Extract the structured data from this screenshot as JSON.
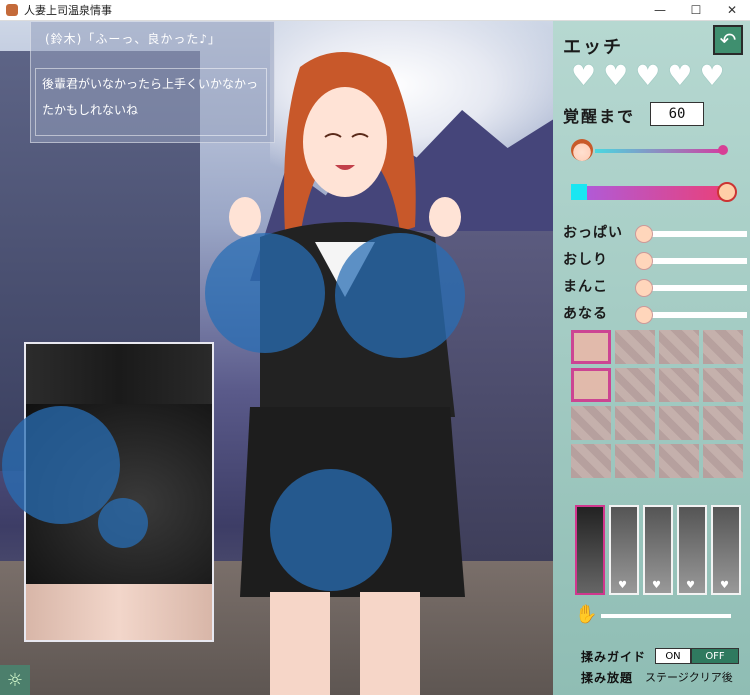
{
  "window": {
    "title": "人妻上司温泉情事",
    "minimize": "—",
    "maximize": "☐",
    "close": "✕"
  },
  "dialog": {
    "speaker": "(鈴木)「ふーっ、良かった♪」",
    "text": "後輩君がいなかったら上手くいかなかったかもしれないね"
  },
  "panel": {
    "title": "エッチ",
    "back_icon": "↶",
    "hearts": [
      "♥",
      "♥",
      "♥",
      "♥",
      "♥"
    ],
    "awake_label": "覚醒まで",
    "awake_value": "60",
    "sliders": [
      {
        "label": "おっぱい"
      },
      {
        "label": "おしり"
      },
      {
        "label": "まんこ"
      },
      {
        "label": "あなる"
      }
    ],
    "guide_label": "揉みガイド",
    "guide_on": "ON",
    "guide_off": "OFF",
    "free_label": "揉み放題",
    "free_value": "ステージクリア後"
  },
  "colors": {
    "panel": "#a9cfc7",
    "accent": "#d1378e",
    "touch": "#2f6fb0"
  }
}
